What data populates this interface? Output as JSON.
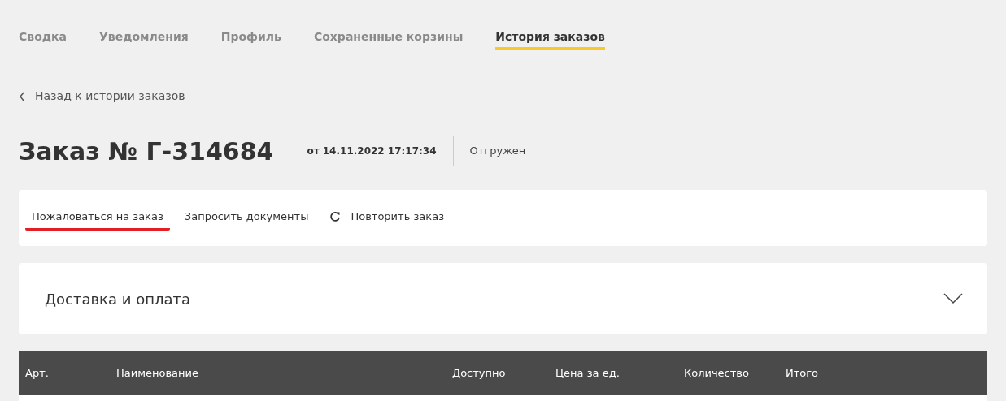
{
  "tabs": [
    {
      "label": "Сводка",
      "selected": false
    },
    {
      "label": "Уведомления",
      "selected": false
    },
    {
      "label": "Профиль",
      "selected": false
    },
    {
      "label": "Сохраненные корзины",
      "selected": false
    },
    {
      "label": "История заказов",
      "selected": true
    }
  ],
  "back_link": "Назад к истории заказов",
  "order": {
    "title": "Заказ № Г-314684",
    "date": "от 14.11.2022 17:17:34",
    "status": "Отгружен"
  },
  "actions": [
    {
      "label": "Пожаловаться на заказ",
      "kind": "plain",
      "highlighted": true
    },
    {
      "label": "Запросить документы",
      "kind": "plain",
      "highlighted": false
    },
    {
      "label": "Повторить заказ",
      "kind": "repeat",
      "highlighted": false
    }
  ],
  "delivery_section": {
    "title": "Доставка и оплата",
    "expanded": false
  },
  "table": {
    "columns": [
      "Арт.",
      "Наименование",
      "Доступно",
      "Цена за ед.",
      "Количество",
      "Итого"
    ]
  }
}
